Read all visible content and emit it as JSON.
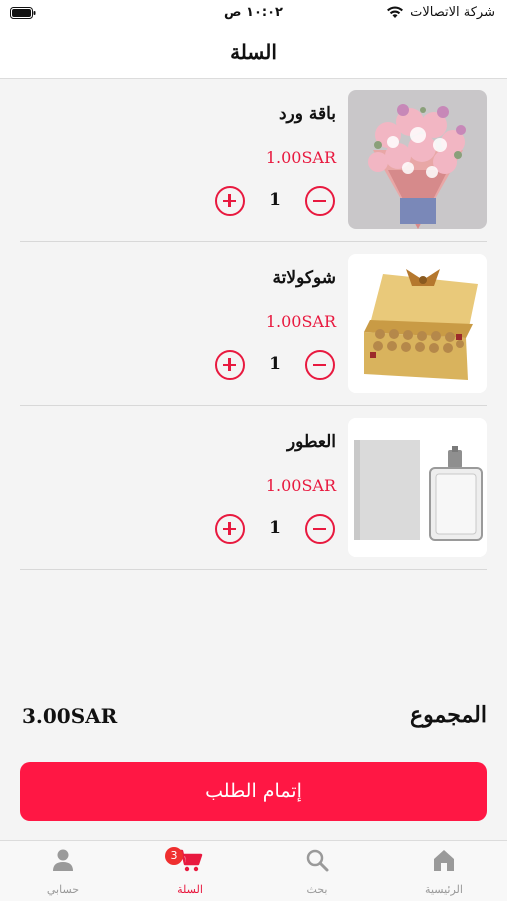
{
  "status_bar": {
    "carrier": "شركة الاتصالات",
    "time": "١٠:٠٢ ص"
  },
  "header": {
    "title": "السلة"
  },
  "cart": {
    "items": [
      {
        "name": "باقة ورد",
        "price": "1.00SAR",
        "quantity": "1",
        "image": "flower-bouquet"
      },
      {
        "name": "شوكولاتة",
        "price": "1.00SAR",
        "quantity": "1",
        "image": "chocolate-box"
      },
      {
        "name": "العطور",
        "price": "1.00SAR",
        "quantity": "1",
        "image": "perfume-bottle"
      }
    ],
    "total_label": "المجموع",
    "total_value": "3.00SAR",
    "checkout_label": "إتمام الطلب"
  },
  "tabs": [
    {
      "label": "الرئيسية",
      "icon": "home-icon"
    },
    {
      "label": "بحث",
      "icon": "search-icon"
    },
    {
      "label": "السلة",
      "icon": "cart-icon",
      "badge": "3",
      "active": true
    },
    {
      "label": "حسابي",
      "icon": "person-icon"
    }
  ],
  "colors": {
    "accent": "#e8193f",
    "button": "#ff1744",
    "badge": "#ef2f2f"
  }
}
